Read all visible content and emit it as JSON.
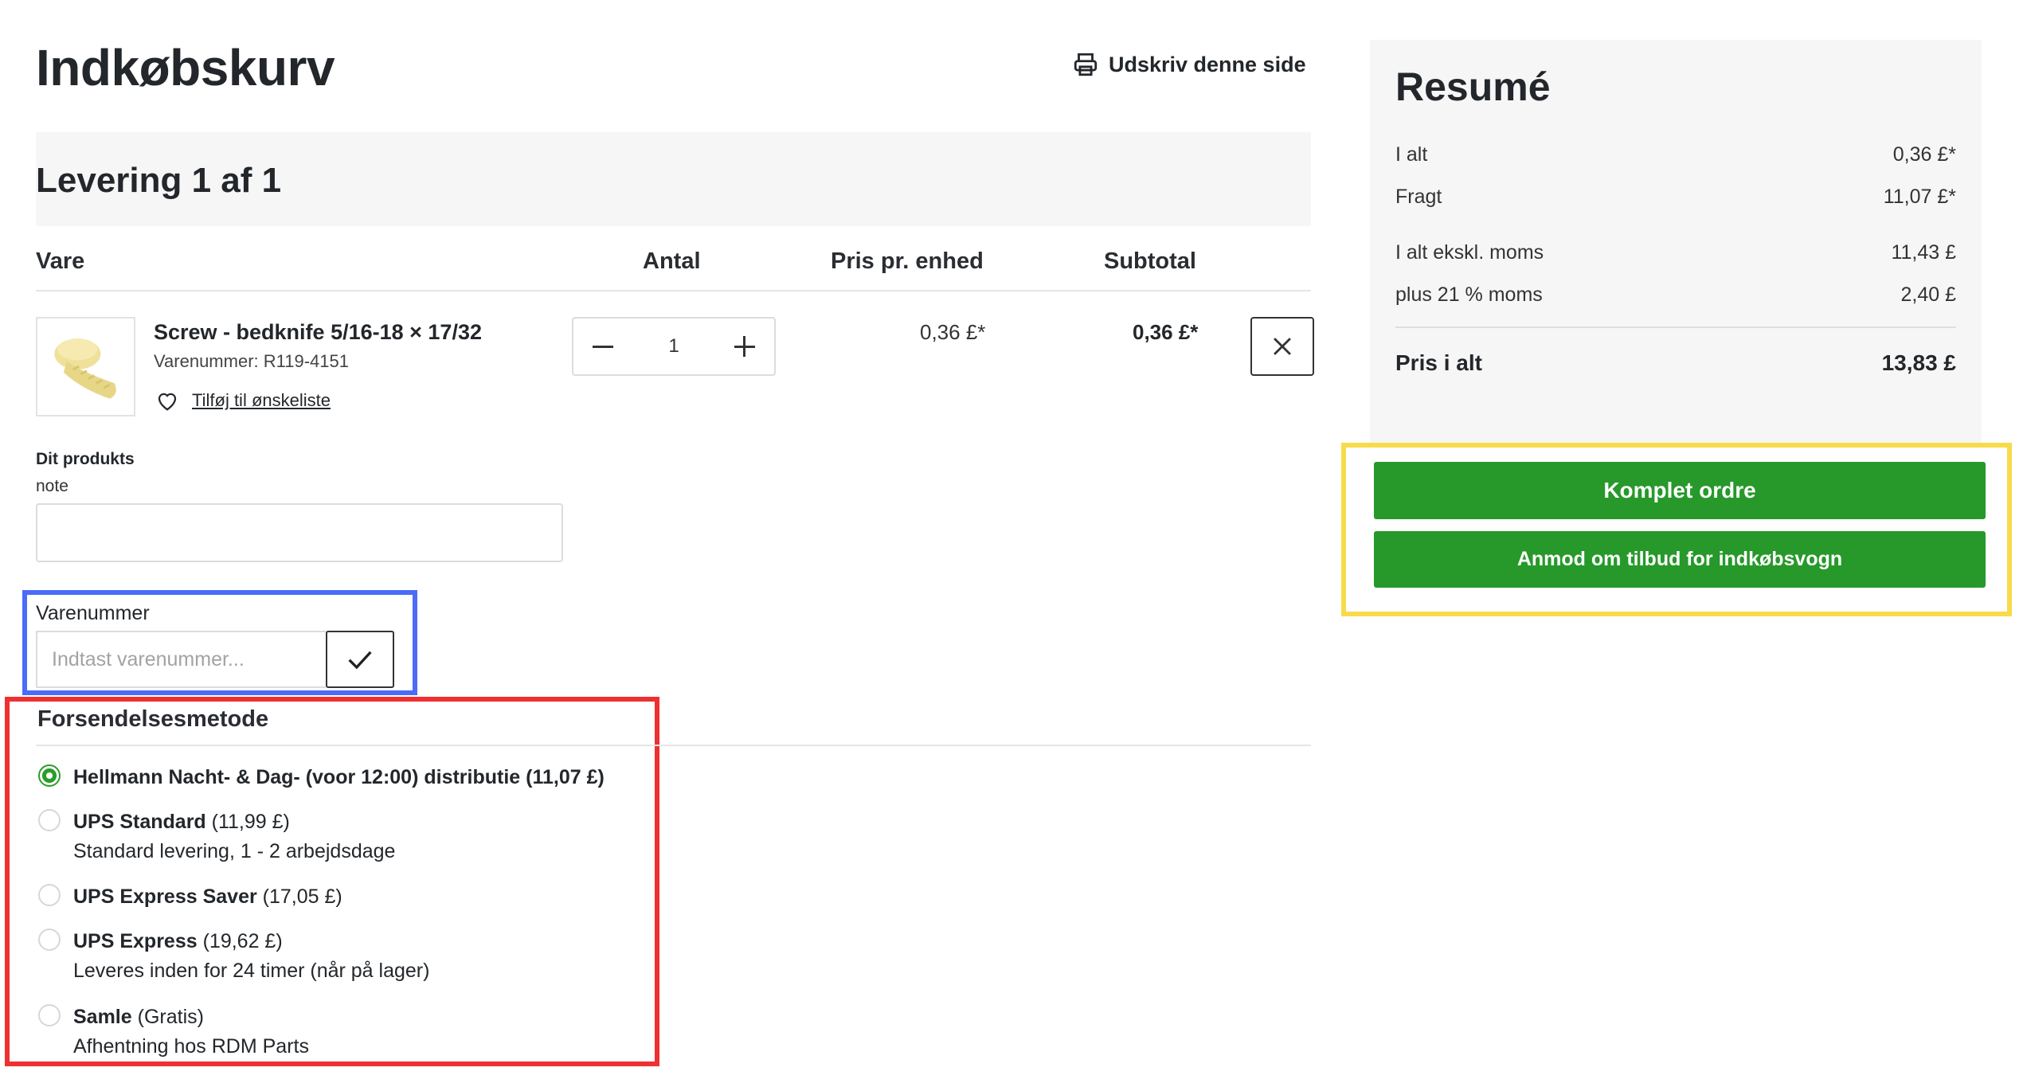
{
  "page": {
    "title": "Indkøbskurv",
    "print_label": "Udskriv denne side"
  },
  "delivery": {
    "title": "Levering 1 af 1"
  },
  "table": {
    "headers": {
      "item": "Vare",
      "qty": "Antal",
      "unit_price": "Pris pr. enhed",
      "subtotal": "Subtotal"
    }
  },
  "item": {
    "name": "Screw - bedknife 5/16-18 × 17/32",
    "sku": "Varenummer: R119-4151",
    "wishlist_label": "Tilføj til ønskeliste",
    "quantity": "1",
    "unit_price": "0,36 £*",
    "subtotal": "0,36 £*",
    "thumb_color": "#f2e39b"
  },
  "note": {
    "label": "Dit produkts",
    "sublabel": "note",
    "value": ""
  },
  "sku_entry": {
    "label": "Varenummer",
    "placeholder": "Indtast varenummer..."
  },
  "shipping": {
    "title": "Forsendelsesmetode",
    "options": [
      {
        "name": "Hellmann Nacht- & Dag- (voor 12:00) distributie (11,07 £)",
        "price": "",
        "description": "",
        "selected": true
      },
      {
        "name": "UPS Standard",
        "price": "(11,99 £)",
        "description": "Standard levering, 1 - 2 arbejdsdage",
        "selected": false
      },
      {
        "name": "UPS Express Saver",
        "price": "(17,05 £)",
        "description": "",
        "selected": false
      },
      {
        "name": "UPS Express",
        "price": "(19,62 £)",
        "description": "Leveres inden for 24 timer (når på lager)",
        "selected": false
      },
      {
        "name": "Samle",
        "price": "(Gratis)",
        "description": "Afhentning hos RDM Parts",
        "selected": false
      }
    ]
  },
  "summary": {
    "title": "Resumé",
    "rows": [
      {
        "label": "I alt",
        "value": "0,36 £*"
      },
      {
        "label": "Fragt",
        "value": "11,07 £*"
      },
      {
        "label": "I alt ekskl. moms",
        "value": "11,43 £"
      },
      {
        "label": "plus 21 % moms",
        "value": "2,40 £"
      }
    ],
    "total_label": "Pris i alt",
    "total_value": "13,83 £"
  },
  "actions": {
    "complete_order": "Komplet ordre",
    "request_quote": "Anmod om tilbud for indkøbsvogn"
  },
  "colors": {
    "primary_green": "#26992a",
    "highlight_blue": "#4a6cf7",
    "highlight_red": "#ee3030",
    "highlight_yellow": "#f7db4a"
  }
}
